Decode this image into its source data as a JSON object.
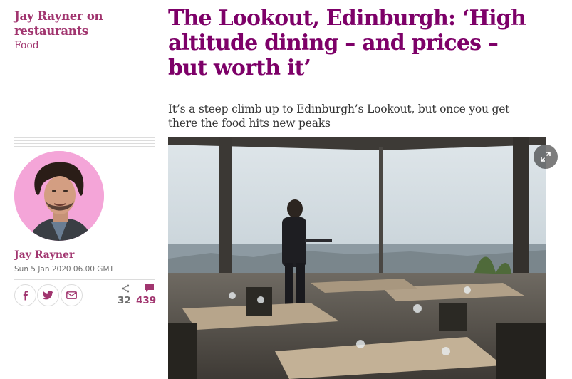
{
  "series": {
    "title": "Jay Rayner on restaurants",
    "section": "Food"
  },
  "article": {
    "headline": "The Lookout, Edinburgh: ‘High altitude dining – and prices – but worth it’",
    "standfirst": "It’s a steep climb up to Edinburgh’s Lookout, but once you get there the food hits new peaks"
  },
  "byline": {
    "author": "Jay Rayner",
    "date": "Sun 5 Jan 2020 06.00 GMT"
  },
  "share": {
    "buttons": [
      "facebook-icon",
      "twitter-icon",
      "email-icon"
    ],
    "share_count": "32",
    "comment_count": "439"
  },
  "colors": {
    "accent": "#a1356f",
    "headline": "#7d0068",
    "avatar_bg": "#f4a5d8"
  }
}
